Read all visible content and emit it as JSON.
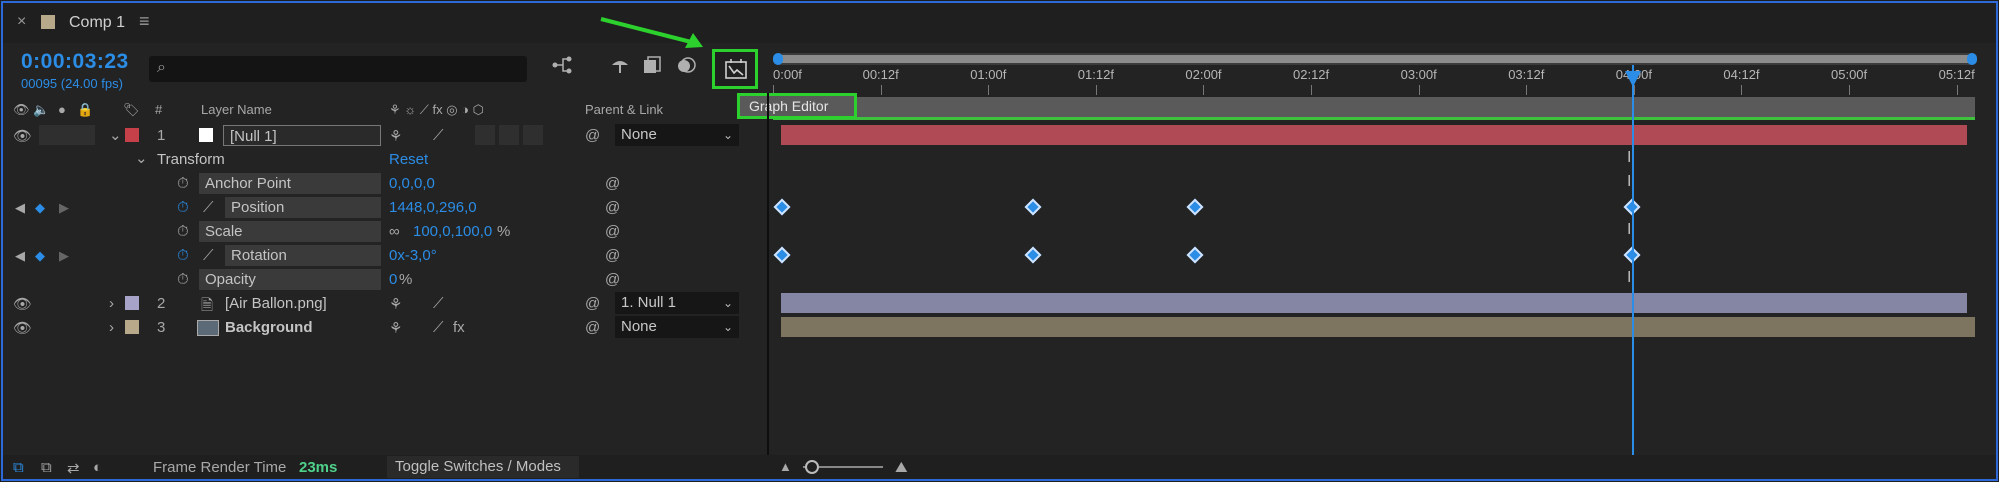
{
  "tab": {
    "close": "×",
    "title": "Comp 1",
    "menu": "≡"
  },
  "header": {
    "timecode": "0:00:03:23",
    "frames": "00095 (24.00 fps)",
    "search_placeholder": "",
    "graph_editor_tooltip": "Graph Editor"
  },
  "columns": {
    "num": "#",
    "layer_name": "Layer Name",
    "parent": "Parent & Link"
  },
  "ruler": {
    "ticks": [
      "0:00f",
      "00:12f",
      "01:00f",
      "01:12f",
      "02:00f",
      "02:12f",
      "03:00f",
      "03:12f",
      "04:00f",
      "04:12f",
      "05:00f",
      "05:12f"
    ]
  },
  "layers": [
    {
      "num": "1",
      "name": "[Null 1]",
      "parent": "None",
      "color": "#c6404a",
      "bar_color": "#b04a55"
    },
    {
      "num": "2",
      "name": "[Air Ballon.png]",
      "parent": "1. Null 1",
      "color": "#a7a2c8",
      "bar_color": "#8585a4"
    },
    {
      "num": "3",
      "name": "Background",
      "parent": "None",
      "color": "#b8a98a",
      "bar_color": "#7e7560"
    }
  ],
  "transform": {
    "label": "Transform",
    "reset": "Reset",
    "properties": [
      {
        "name": "Anchor Point",
        "value": "0,0,0,0"
      },
      {
        "name": "Position",
        "value": "1448,0,296,0"
      },
      {
        "name": "Scale",
        "value": "100,0,100,0",
        "unit": "%"
      },
      {
        "name": "Rotation",
        "value": "0x-3,0°"
      },
      {
        "name": "Opacity",
        "value": "0",
        "unit": "%"
      }
    ]
  },
  "footer": {
    "frame_render_label": "Frame Render Time",
    "frame_render_value": "23ms",
    "toggle_label": "Toggle Switches / Modes"
  },
  "colors": {
    "accent": "#2b8de6",
    "highlight": "#2dd12d"
  }
}
